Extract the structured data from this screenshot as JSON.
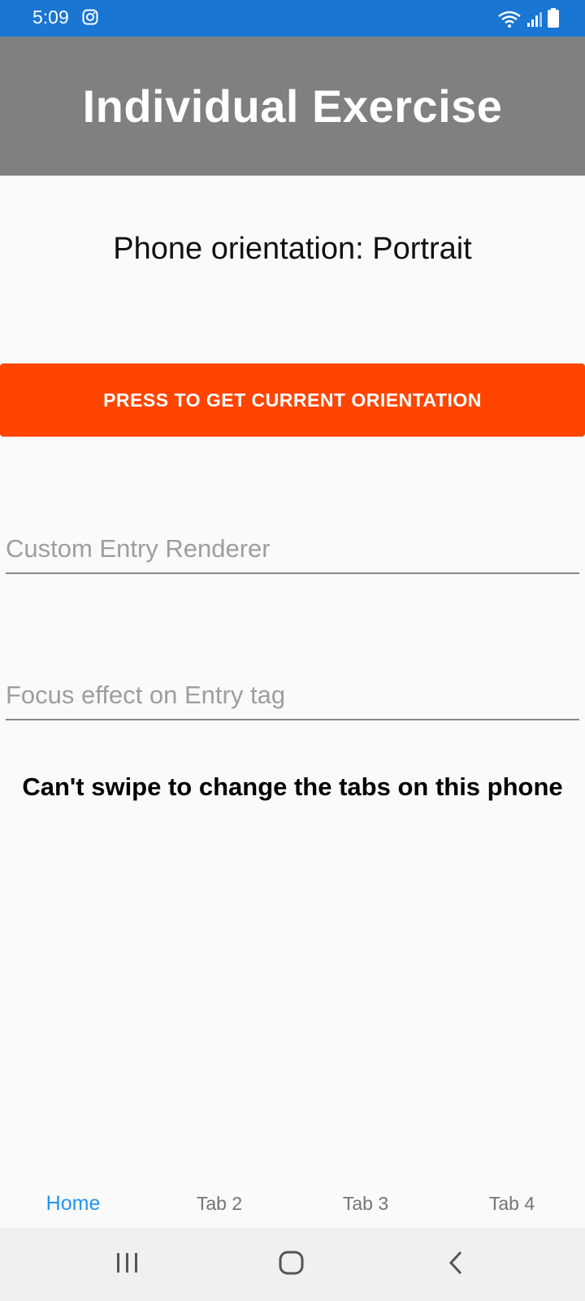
{
  "status_bar": {
    "time": "5:09",
    "icons": [
      "instagram-icon",
      "wifi-icon",
      "signal-icon",
      "battery-icon"
    ],
    "color": "#1976d2"
  },
  "header": {
    "title": "Individual Exercise",
    "color": "#808080"
  },
  "main": {
    "orientation_text": "Phone orientation: Portrait",
    "orientation_button_label": "PRESS TO GET CURRENT ORIENTATION",
    "button_color": "#ff4500",
    "entry1_placeholder": "Custom Entry Renderer",
    "entry2_placeholder": "Focus effect on Entry tag",
    "swipe_note": "Can't swipe to change the tabs on this phone"
  },
  "tabs": [
    {
      "label": "Home",
      "active": true
    },
    {
      "label": "Tab 2",
      "active": false
    },
    {
      "label": "Tab 3",
      "active": false
    },
    {
      "label": "Tab 4",
      "active": false
    }
  ],
  "accent_color": "#2196f3",
  "nav_bar": {
    "icons": [
      "recent-apps-icon",
      "home-icon",
      "back-icon"
    ]
  }
}
